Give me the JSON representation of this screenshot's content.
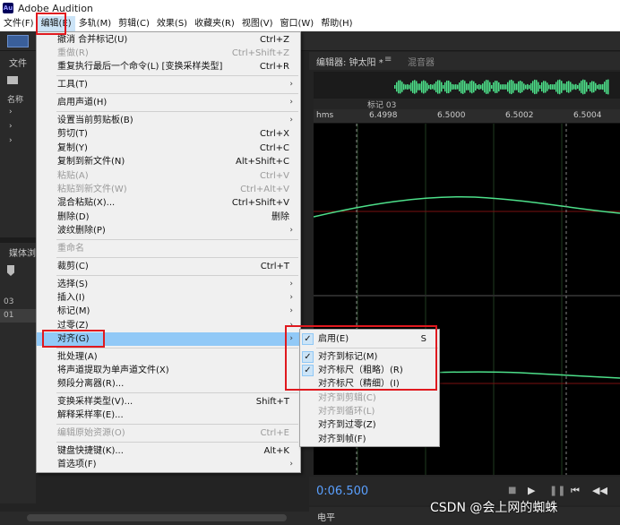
{
  "window": {
    "app_icon_text": "Au",
    "title": "Adobe Audition"
  },
  "menubar": [
    {
      "label": "文件(F)"
    },
    {
      "label": "编辑(E)"
    },
    {
      "label": "多轨(M)"
    },
    {
      "label": "剪辑(C)"
    },
    {
      "label": "效果(S)"
    },
    {
      "label": "收藏夹(R)"
    },
    {
      "label": "视图(V)"
    },
    {
      "label": "窗口(W)"
    },
    {
      "label": "帮助(H)"
    }
  ],
  "left_panel": {
    "files_tab": "文件",
    "name_col": "名称",
    "media_tab": "媒体浏",
    "rows": [
      "03",
      "01"
    ]
  },
  "editor": {
    "tab_label": "编辑器: 钟太阳 *",
    "mixer_tab": "混音器",
    "marker_label": "标记 03",
    "ruler_labels": [
      "hms",
      "6.4998",
      "6.5000",
      "6.5002",
      "6.5004"
    ],
    "time": "0:06.500",
    "level_label": "电平"
  },
  "edit_menu": [
    {
      "label": "撤消 合并标记(U)",
      "shortcut": "Ctrl+Z",
      "disabled": false
    },
    {
      "label": "重做(R)",
      "shortcut": "Ctrl+Shift+Z",
      "disabled": true
    },
    {
      "label": "重复执行最后一个命令(L) [变换采样类型]",
      "shortcut": "Ctrl+R",
      "disabled": false
    },
    {
      "label": "工具(T)",
      "submenu": true
    },
    {
      "label": "启用声道(H)",
      "submenu": true
    },
    {
      "label": "设置当前剪贴板(B)",
      "submenu": true
    },
    {
      "label": "剪切(T)",
      "shortcut": "Ctrl+X"
    },
    {
      "label": "复制(Y)",
      "shortcut": "Ctrl+C"
    },
    {
      "label": "复制到新文件(N)",
      "shortcut": "Alt+Shift+C"
    },
    {
      "label": "粘贴(A)",
      "shortcut": "Ctrl+V",
      "disabled": true
    },
    {
      "label": "粘贴到新文件(W)",
      "shortcut": "Ctrl+Alt+V",
      "disabled": true
    },
    {
      "label": "混合粘贴(X)...",
      "shortcut": "Ctrl+Shift+V"
    },
    {
      "label": "删除(D)",
      "shortcut": "删除"
    },
    {
      "label": "波纹删除(P)",
      "submenu": true
    },
    {
      "label": "重命名",
      "disabled": true
    },
    {
      "label": "裁剪(C)",
      "shortcut": "Ctrl+T"
    },
    {
      "label": "选择(S)",
      "submenu": true
    },
    {
      "label": "插入(I)",
      "submenu": true
    },
    {
      "label": "标记(M)",
      "submenu": true
    },
    {
      "label": "过零(Z)",
      "submenu": true
    },
    {
      "label": "对齐(G)",
      "submenu": true,
      "highlighted": true
    },
    {
      "label": "批处理(A)"
    },
    {
      "label": "将声道提取为单声道文件(X)"
    },
    {
      "label": "频段分离器(R)..."
    },
    {
      "label": "变换采样类型(V)...",
      "shortcut": "Shift+T"
    },
    {
      "label": "解释采样率(E)..."
    },
    {
      "label": "编辑原始资源(O)",
      "shortcut": "Ctrl+E",
      "disabled": true
    },
    {
      "label": "键盘快捷键(K)...",
      "shortcut": "Alt+K"
    },
    {
      "label": "首选项(F)",
      "submenu": true
    }
  ],
  "align_submenu": [
    {
      "label": "启用(E)",
      "shortcut": "S",
      "checked": true
    },
    {
      "label": "对齐到标记(M)",
      "checked": true
    },
    {
      "label": "对齐标尺（粗略）(R)",
      "checked": true
    },
    {
      "label": "对齐标尺（精细）(I)",
      "checked": false
    },
    {
      "label": "对齐到剪辑(C)",
      "disabled": true
    },
    {
      "label": "对齐到循环(L)",
      "disabled": true
    },
    {
      "label": "对齐到过零(Z)"
    },
    {
      "label": "对齐到帧(F)"
    }
  ],
  "check_glyph": "✓",
  "arrow_glyph": "›",
  "watermark": "CSDN @会上网的蜘蛛",
  "colors": {
    "highlight": "#91c9f7",
    "annotation_red": "#e0191f",
    "waveform": "#4de08a",
    "time": "#5aa0ff"
  }
}
